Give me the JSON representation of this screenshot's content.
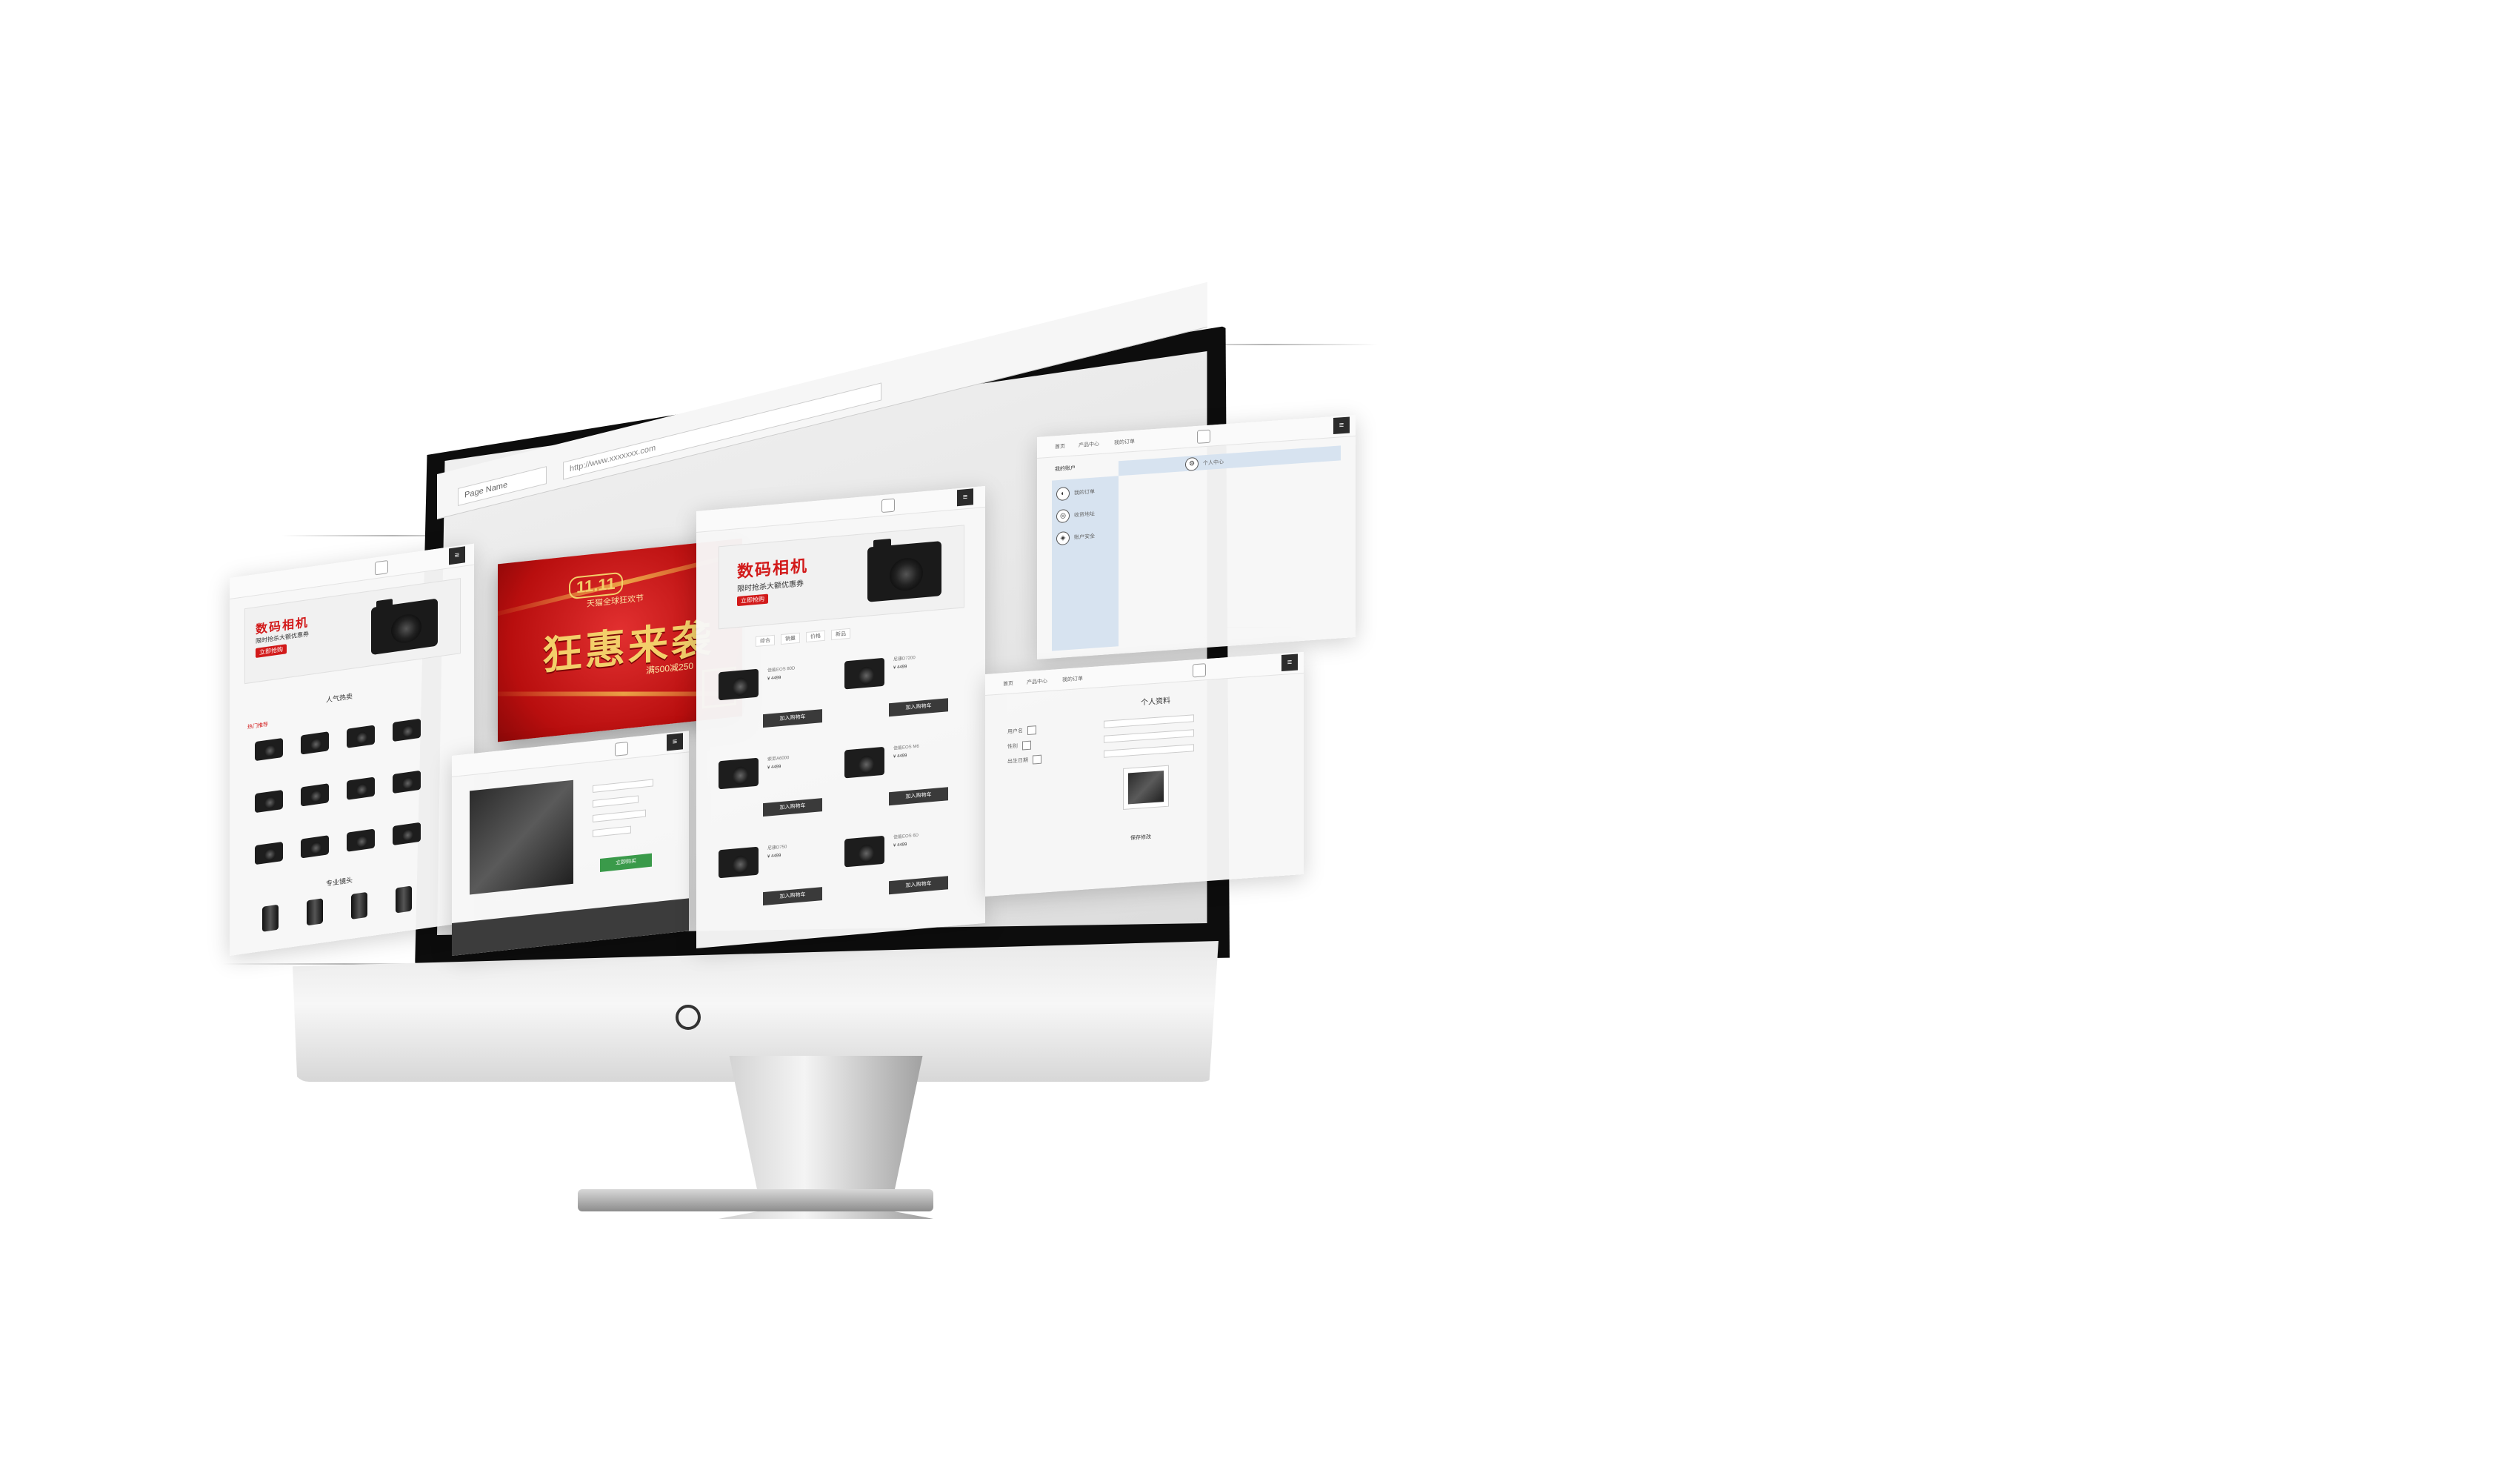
{
  "browser": {
    "tab_label": "Page Name",
    "url_text": "http://www.xxxxxxx.com"
  },
  "left_panel": {
    "banner_title": "数码相机",
    "banner_sub": "限时抢杀大额优惠券",
    "banner_tag": "立即抢购",
    "section_title": "人气热卖",
    "section_title2": "专业镜头",
    "tab_active": "热门推荐"
  },
  "promo_banner": {
    "badge": "11.11",
    "top_line": "天猫全球狂欢节",
    "main_text": "狂惠来袭",
    "price_text": "满500减250"
  },
  "product_list_panel": {
    "banner_title": "数码相机",
    "banner_sub": "限时抢杀大额优惠券",
    "banner_tag": "立即抢购",
    "sort_tabs": [
      "综合",
      "销量",
      "价格",
      "新品"
    ],
    "items": [
      {
        "name": "佳能EOS 80D",
        "price": "¥ 4499",
        "button": "加入购物车"
      },
      {
        "name": "尼康D7200",
        "price": "¥ 4499",
        "button": "加入购物车"
      },
      {
        "name": "索尼A6000",
        "price": "¥ 4499",
        "button": "加入购物车"
      },
      {
        "name": "佳能EOS M6",
        "price": "¥ 4499",
        "button": "加入购物车"
      },
      {
        "name": "尼康D750",
        "price": "¥ 4499",
        "button": "加入购物车"
      },
      {
        "name": "佳能EOS 6D",
        "price": "¥ 4499",
        "button": "加入购物车"
      }
    ]
  },
  "detail_panel": {
    "buy_button": "立即购买"
  },
  "user_menu_panel": {
    "nav": [
      "首页",
      "产品中心",
      "我的订单"
    ],
    "header_label": "我的账户",
    "items": [
      "我的订单",
      "收货地址",
      "账户安全"
    ],
    "side_header": "个人中心"
  },
  "personal_panel": {
    "nav": [
      "首页",
      "产品中心",
      "我的订单"
    ],
    "title": "个人资料",
    "fields": [
      "用户名",
      "性别",
      "出生日期"
    ],
    "save_label": "保存修改"
  }
}
